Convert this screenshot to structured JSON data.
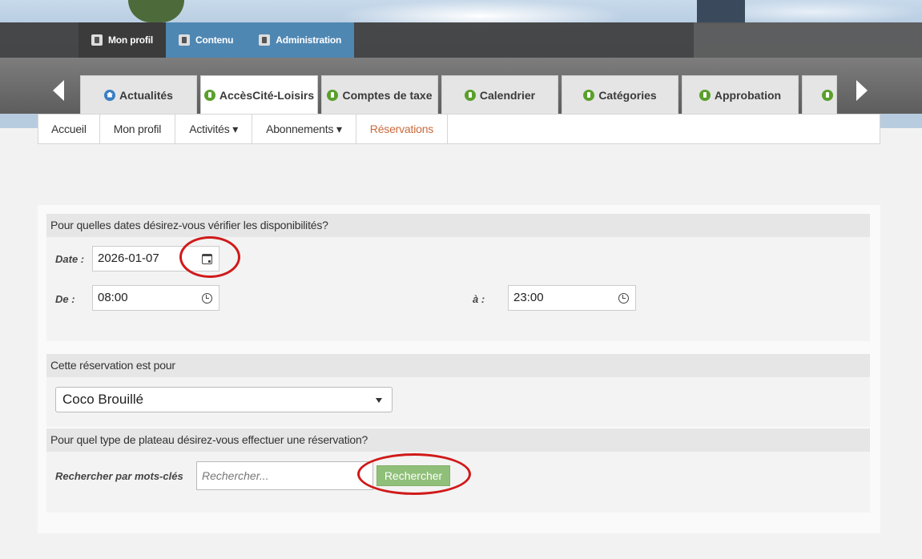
{
  "admin_bar": {
    "items": [
      {
        "label": "Mon profil",
        "icon": "user-icon"
      },
      {
        "label": "Contenu",
        "icon": "document-icon"
      },
      {
        "label": "Administration",
        "icon": "wrench-icon"
      }
    ]
  },
  "module_tabs": [
    {
      "label": "Actualités",
      "icon": "home-icon"
    },
    {
      "label": "AccèsCité-Loisirs",
      "icon": "module-icon",
      "active": true
    },
    {
      "label": "Comptes de taxe",
      "icon": "module-icon"
    },
    {
      "label": "Calendrier",
      "icon": "module-icon"
    },
    {
      "label": "Catégories",
      "icon": "module-icon"
    },
    {
      "label": "Approbation",
      "icon": "module-icon"
    }
  ],
  "subnav": {
    "items": [
      {
        "label": "Accueil"
      },
      {
        "label": "Mon profil"
      },
      {
        "label": "Activités ▾"
      },
      {
        "label": "Abonnements ▾"
      },
      {
        "label": "Réservations",
        "current": true
      }
    ]
  },
  "dates_section": {
    "heading": "Pour quelles dates désirez-vous vérifier les disponibilités?",
    "date_label": "Date :",
    "date_value": "2026-01-07",
    "from_label": "De :",
    "from_value": "08:00",
    "to_label": "à :",
    "to_value": "23:00"
  },
  "for_section": {
    "heading": "Cette réservation est pour",
    "selected": "Coco Brouillé"
  },
  "type_section": {
    "heading": "Pour quel type de plateau désirez-vous effectuer une réservation?",
    "keyword_label": "Rechercher par mots-clés",
    "search_placeholder": "Rechercher...",
    "search_button": "Rechercher"
  },
  "colors": {
    "accent_blue": "#4f87b3",
    "module_green": "#5aa02c",
    "current_link": "#c96a3c",
    "search_button": "#8fbf78",
    "highlight_ring": "#d01a1a"
  }
}
